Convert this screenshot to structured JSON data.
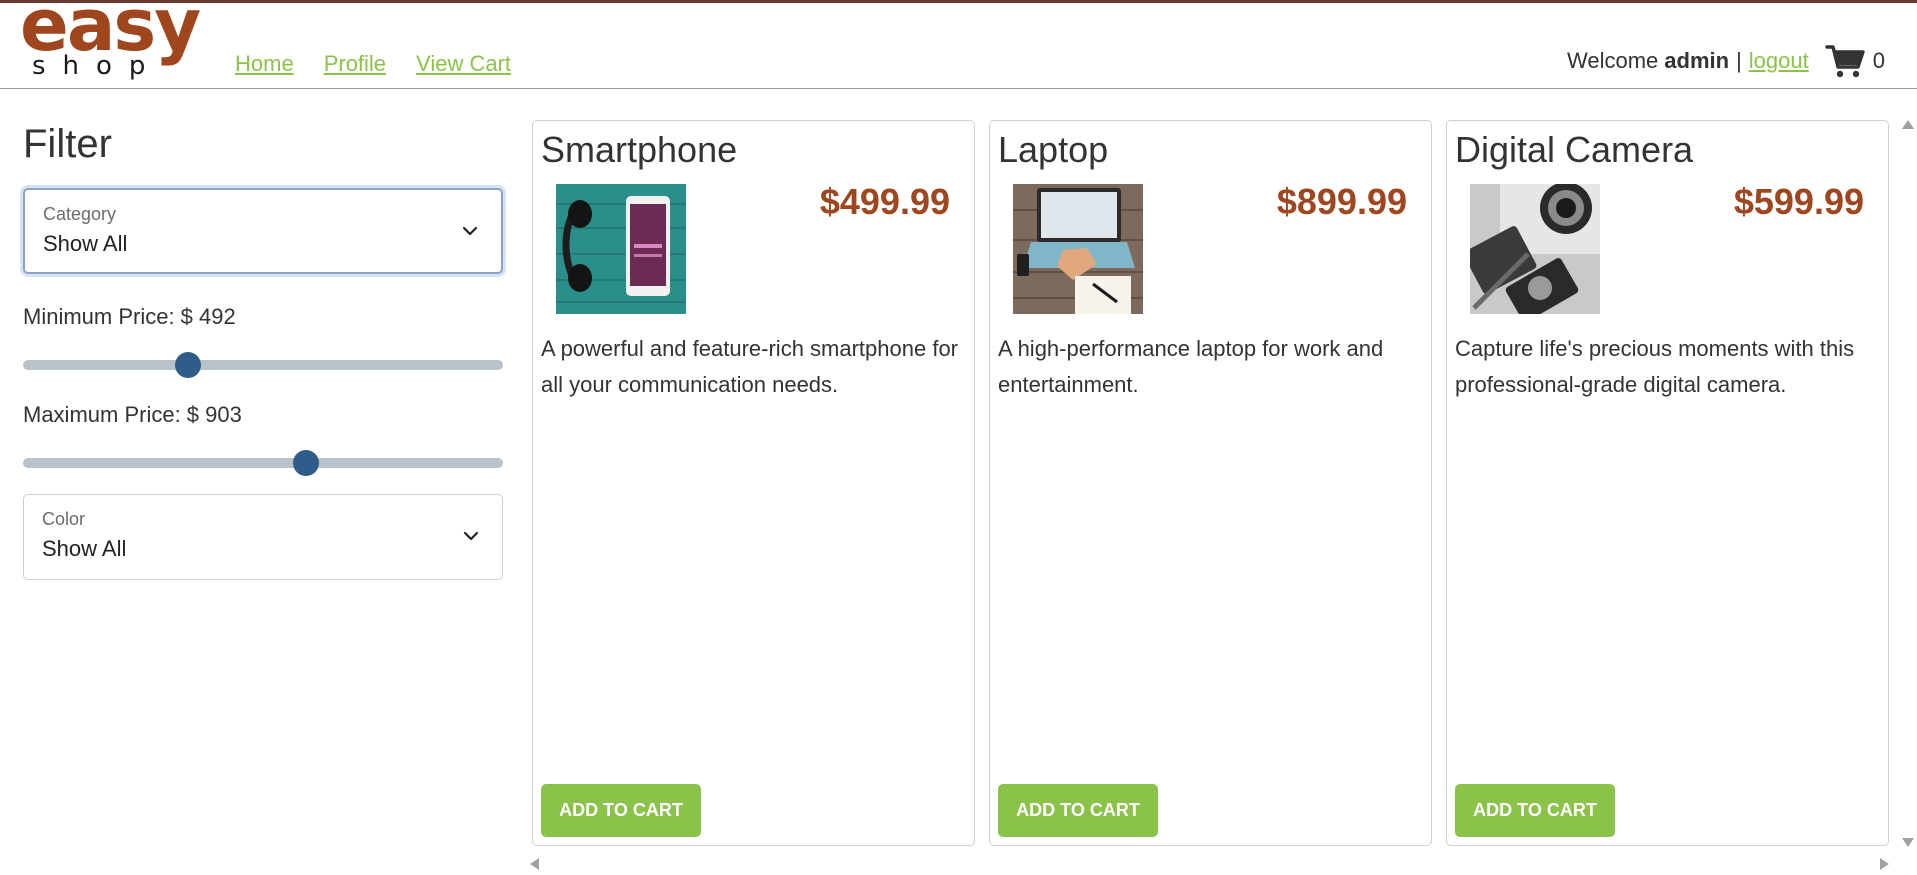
{
  "header": {
    "logo": {
      "word1": "easy",
      "word2": "shop"
    },
    "nav": [
      {
        "label": "Home"
      },
      {
        "label": "Profile"
      },
      {
        "label": "View Cart"
      }
    ],
    "welcome_prefix": "Welcome",
    "username": "admin",
    "separator": "|",
    "logout_label": "logout",
    "cart_icon": "shopping-cart-icon",
    "cart_count": "0"
  },
  "filter": {
    "title": "Filter",
    "category": {
      "label": "Category",
      "value": "Show All"
    },
    "min_price": {
      "label": "Minimum Price: $ 492",
      "value": 492,
      "position_fraction": 0.335
    },
    "max_price": {
      "label": "Maximum Price: $ 903",
      "value": 903,
      "position_fraction": 0.595
    },
    "color": {
      "label": "Color",
      "value": "Show All"
    }
  },
  "products": [
    {
      "name": "Smartphone",
      "price": "$499.99",
      "description": "A powerful and feature-rich smartphone for all your communication needs.",
      "button": "ADD TO CART",
      "image": "smartphone-photo"
    },
    {
      "name": "Laptop",
      "price": "$899.99",
      "description": "A high-performance laptop for work and entertainment.",
      "button": "ADD TO CART",
      "image": "laptop-photo"
    },
    {
      "name": "Digital Camera",
      "price": "$599.99",
      "description": "Capture life's precious moments with this professional-grade digital camera.",
      "button": "ADD TO CART",
      "image": "camera-photo"
    }
  ],
  "colors": {
    "accent_green": "#8bc34a",
    "brand_brown": "#a0461e",
    "slider_thumb": "#2f5d8a"
  }
}
